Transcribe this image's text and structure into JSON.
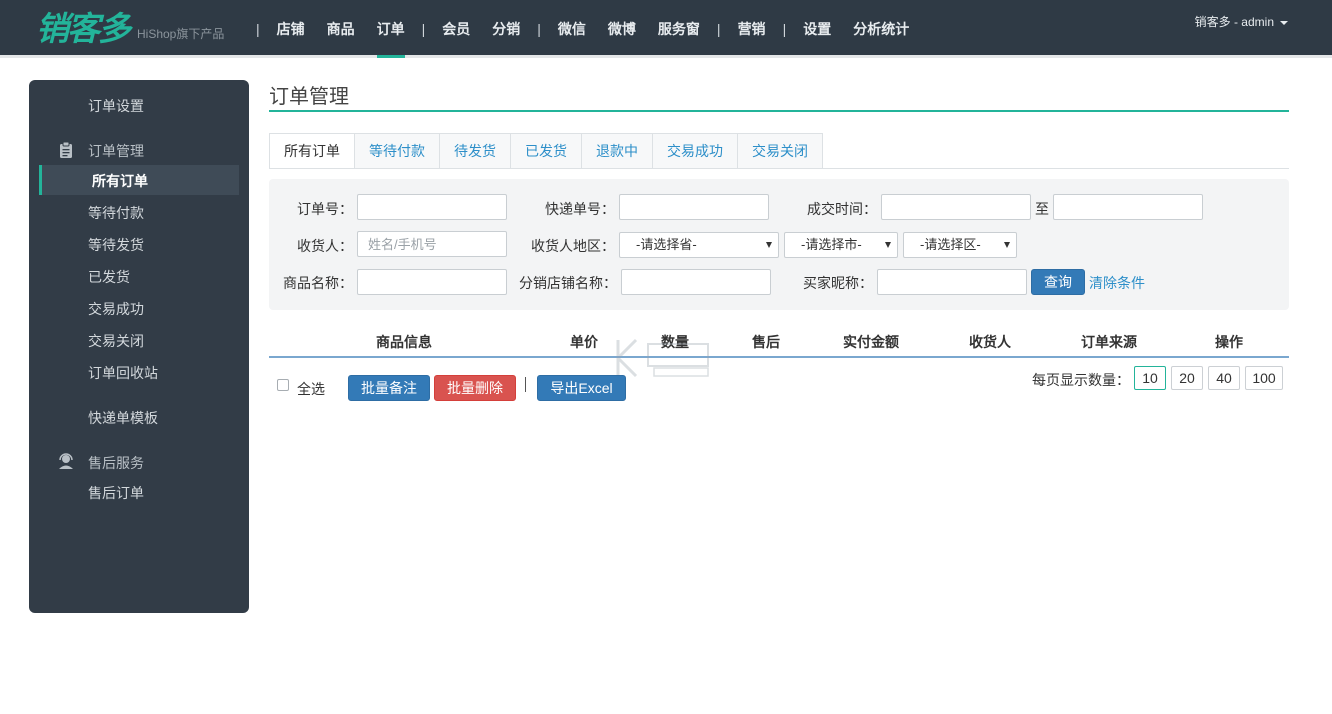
{
  "header": {
    "logo": "销客多",
    "logo_sub": "HiShop旗下产品",
    "nav": [
      {
        "label": "店铺"
      },
      {
        "label": "商品"
      },
      {
        "label": "订单"
      },
      {
        "label": "会员"
      },
      {
        "label": "分销"
      },
      {
        "label": "微信"
      },
      {
        "label": "微博"
      },
      {
        "label": "服务窗"
      },
      {
        "label": "营销"
      },
      {
        "label": "设置"
      },
      {
        "label": "分析统计"
      }
    ],
    "separator": "|",
    "user": "销客多 - admin"
  },
  "sidebar": {
    "order_settings": "订单设置",
    "order_management": "订单管理",
    "items": [
      "所有订单",
      "等待付款",
      "等待发货",
      "已发货",
      "交易成功",
      "交易关闭",
      "订单回收站"
    ],
    "express_template": "快递单模板",
    "after_sales": "售后服务",
    "after_sales_orders": "售后订单"
  },
  "main": {
    "title": "订单管理",
    "tabs": [
      {
        "label": "所有订单"
      },
      {
        "label": "等待付款"
      },
      {
        "label": "待发货"
      },
      {
        "label": "已发货"
      },
      {
        "label": "退款中"
      },
      {
        "label": "交易成功"
      },
      {
        "label": "交易关闭"
      }
    ],
    "filters": {
      "order_no": "订单号：",
      "express_no": "快递单号：",
      "deal_time": "成交时间：",
      "to": "至",
      "receiver": "收货人：",
      "receiver_placeholder": "姓名/手机号",
      "region": "收货人地区：",
      "province": "-请选择省-",
      "city": "-请选择市-",
      "district": "-请选择区-",
      "product_name": "商品名称：",
      "shop_name": "分销店铺名称：",
      "buyer_nick": "买家昵称：",
      "search": "查询",
      "clear": "清除条件"
    },
    "table_headers": [
      "商品信息",
      "单价",
      "数量",
      "售后",
      "实付金额",
      "收货人",
      "订单来源",
      "操作"
    ],
    "actions": {
      "select_all": "全选",
      "batch_note": "批量备注",
      "batch_delete": "批量删除",
      "separator": "|",
      "export": "导出Excel"
    },
    "pagination": {
      "label": "每页显示数量：",
      "options": [
        "10",
        "20",
        "40",
        "100"
      ],
      "selected": "10"
    }
  }
}
